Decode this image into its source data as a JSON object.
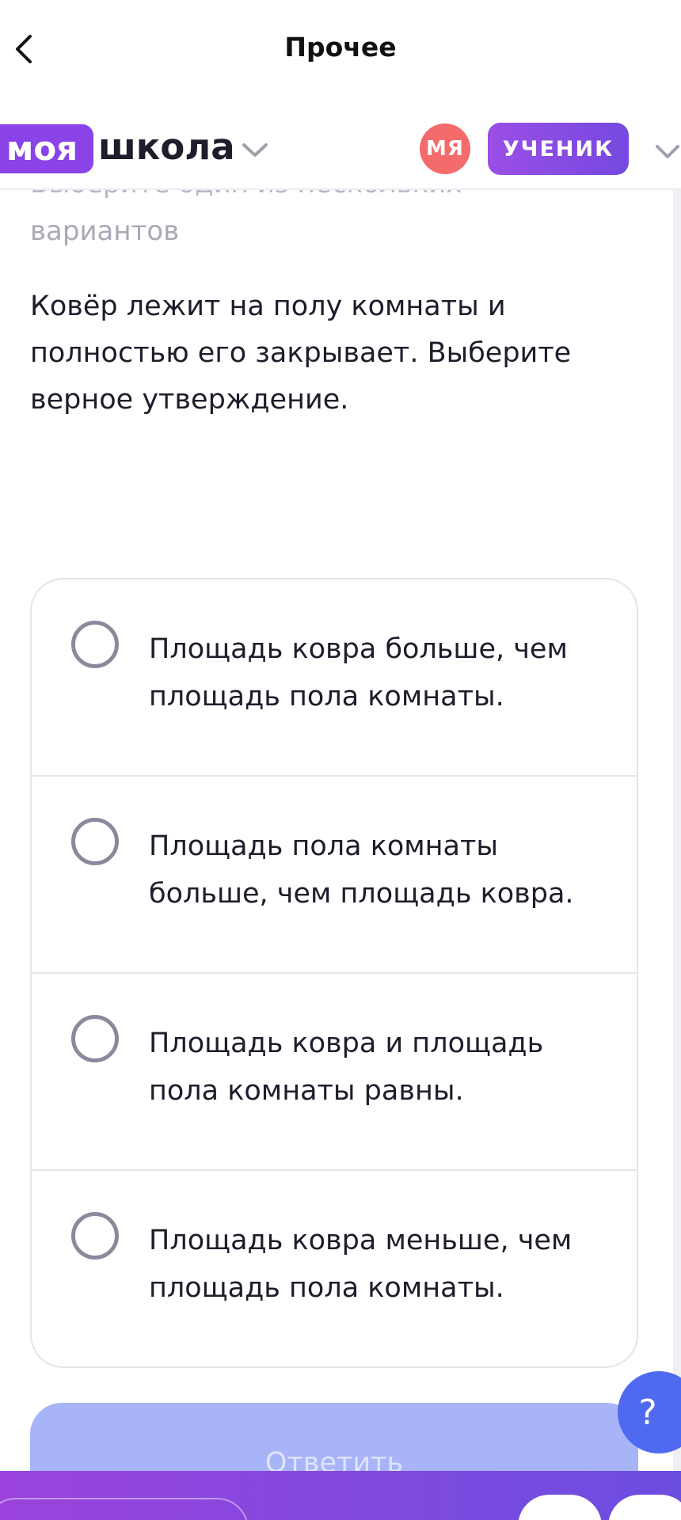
{
  "topbar": {
    "title": "Прочее"
  },
  "brand": {
    "logo_part1": "моя",
    "logo_part2": "школа"
  },
  "user": {
    "avatar_initials": "МЯ",
    "role": "УЧЕНИК"
  },
  "task": {
    "instruction_line1": "Выберите один из нескольких",
    "instruction_line2": "вариантов",
    "question": "Ковёр лежит на полу комнаты и полностью его закрывает. Выберите верное утверждение.",
    "options": [
      "Площадь ковра больше, чем площадь пола комнаты.",
      "Площадь пола комнаты больше, чем площадь ковра.",
      "Площадь ковра и площадь пола комнаты равны.",
      "Площадь ковра меньше, чем площадь пола комнаты."
    ],
    "selected_option": null
  },
  "actions": {
    "answer_label": "Ответить",
    "help_label": "?"
  },
  "colors": {
    "brand_purple": "#8a43e6",
    "avatar_red": "#f36b6b",
    "answer_disabled": "#a8b4f8",
    "help_blue": "#4f6af0"
  }
}
